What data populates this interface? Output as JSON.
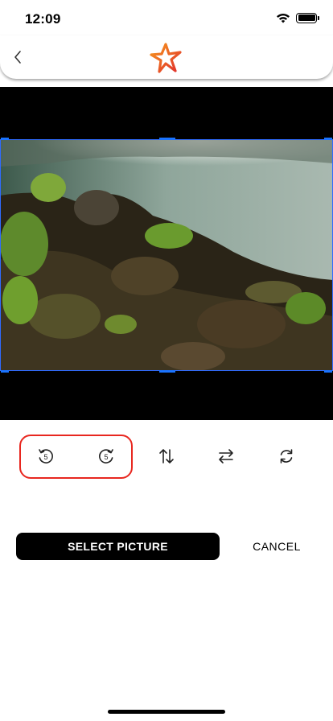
{
  "status_bar": {
    "time": "12:09"
  },
  "nav": {
    "back_icon": "chevron-left-icon",
    "logo": "star-logo"
  },
  "toolbar": {
    "rotate_left": {
      "icon": "rotate-left-icon",
      "label": "5"
    },
    "rotate_right": {
      "icon": "rotate-right-icon",
      "label": "5"
    },
    "flip_vertical": {
      "icon": "flip-vertical-icon"
    },
    "flip_horizontal": {
      "icon": "flip-horizontal-icon"
    },
    "reset": {
      "icon": "reset-rotate-icon"
    }
  },
  "actions": {
    "select_label": "SELECT PICTURE",
    "cancel_label": "CANCEL"
  },
  "colors": {
    "accent": "#1A73FF",
    "highlight": "#E8271F",
    "logo_orange": "#F26B1D",
    "logo_red": "#E02D2D"
  }
}
